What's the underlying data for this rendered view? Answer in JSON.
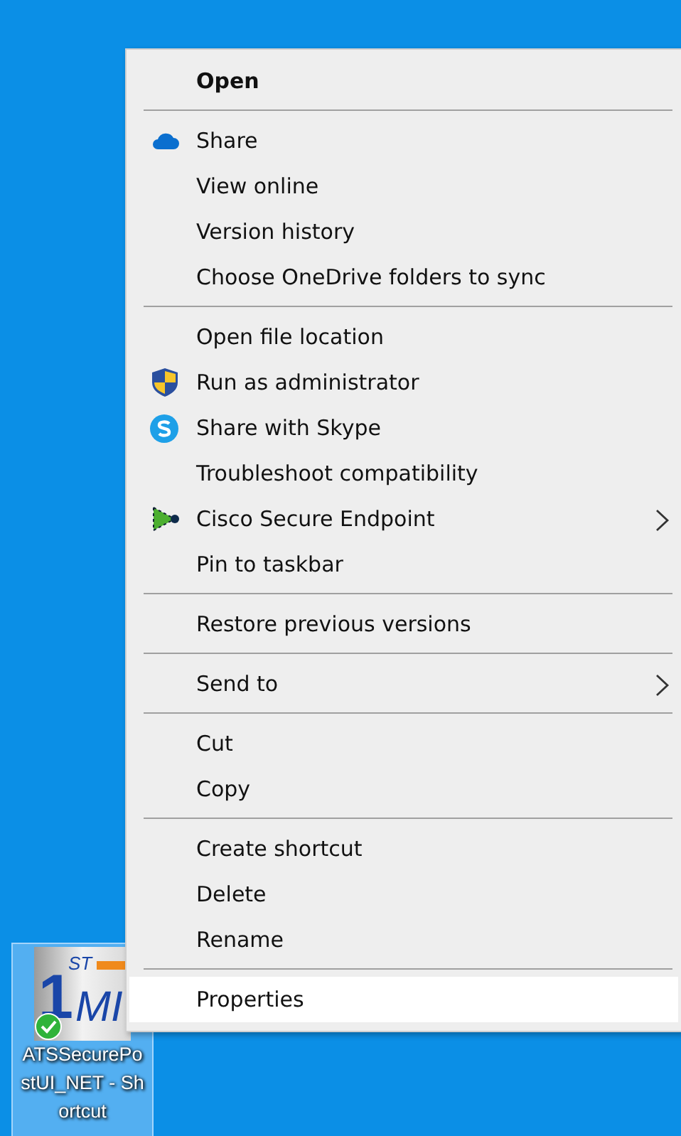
{
  "context_menu": {
    "items": [
      {
        "kind": "item",
        "label": "Open",
        "default": true,
        "selected": false,
        "submenu": false
      },
      {
        "kind": "separator"
      },
      {
        "kind": "cloud",
        "label": "Share",
        "default": false,
        "selected": false,
        "submenu": false
      },
      {
        "kind": "item",
        "label": "View online",
        "default": false,
        "selected": false,
        "submenu": false
      },
      {
        "kind": "item",
        "label": "Version history",
        "default": false,
        "selected": false,
        "submenu": false
      },
      {
        "kind": "item",
        "label": "Choose OneDrive folders to sync",
        "default": false,
        "selected": false,
        "submenu": false
      },
      {
        "kind": "separator"
      },
      {
        "kind": "item",
        "label": "Open file location",
        "default": false,
        "selected": false,
        "submenu": false
      },
      {
        "kind": "shield",
        "label": "Run as administrator",
        "default": false,
        "selected": false,
        "submenu": false
      },
      {
        "kind": "skype",
        "label": "Share with Skype",
        "default": false,
        "selected": false,
        "submenu": false
      },
      {
        "kind": "item",
        "label": "Troubleshoot compatibility",
        "default": false,
        "selected": false,
        "submenu": false
      },
      {
        "kind": "arrow",
        "label": "Cisco Secure Endpoint",
        "default": false,
        "selected": false,
        "submenu": true
      },
      {
        "kind": "item",
        "label": "Pin to taskbar",
        "default": false,
        "selected": false,
        "submenu": false
      },
      {
        "kind": "separator"
      },
      {
        "kind": "item",
        "label": "Restore previous versions",
        "default": false,
        "selected": false,
        "submenu": false
      },
      {
        "kind": "separator"
      },
      {
        "kind": "item",
        "label": "Send to",
        "default": false,
        "selected": false,
        "submenu": true
      },
      {
        "kind": "separator"
      },
      {
        "kind": "item",
        "label": "Cut",
        "default": false,
        "selected": false,
        "submenu": false
      },
      {
        "kind": "item",
        "label": "Copy",
        "default": false,
        "selected": false,
        "submenu": false
      },
      {
        "kind": "separator"
      },
      {
        "kind": "item",
        "label": "Create shortcut",
        "default": false,
        "selected": false,
        "submenu": false
      },
      {
        "kind": "item",
        "label": "Delete",
        "default": false,
        "selected": false,
        "submenu": false
      },
      {
        "kind": "item",
        "label": "Rename",
        "default": false,
        "selected": false,
        "submenu": false
      },
      {
        "kind": "separator"
      },
      {
        "kind": "item",
        "label": "Properties",
        "default": false,
        "selected": true,
        "submenu": false
      }
    ]
  },
  "desktop_icon": {
    "label": "ATSSecurePostUI_NET - Shortcut",
    "selected": true,
    "synced": true,
    "logo": {
      "numeral": "1",
      "superscript": "ST",
      "letters": "MI"
    }
  }
}
